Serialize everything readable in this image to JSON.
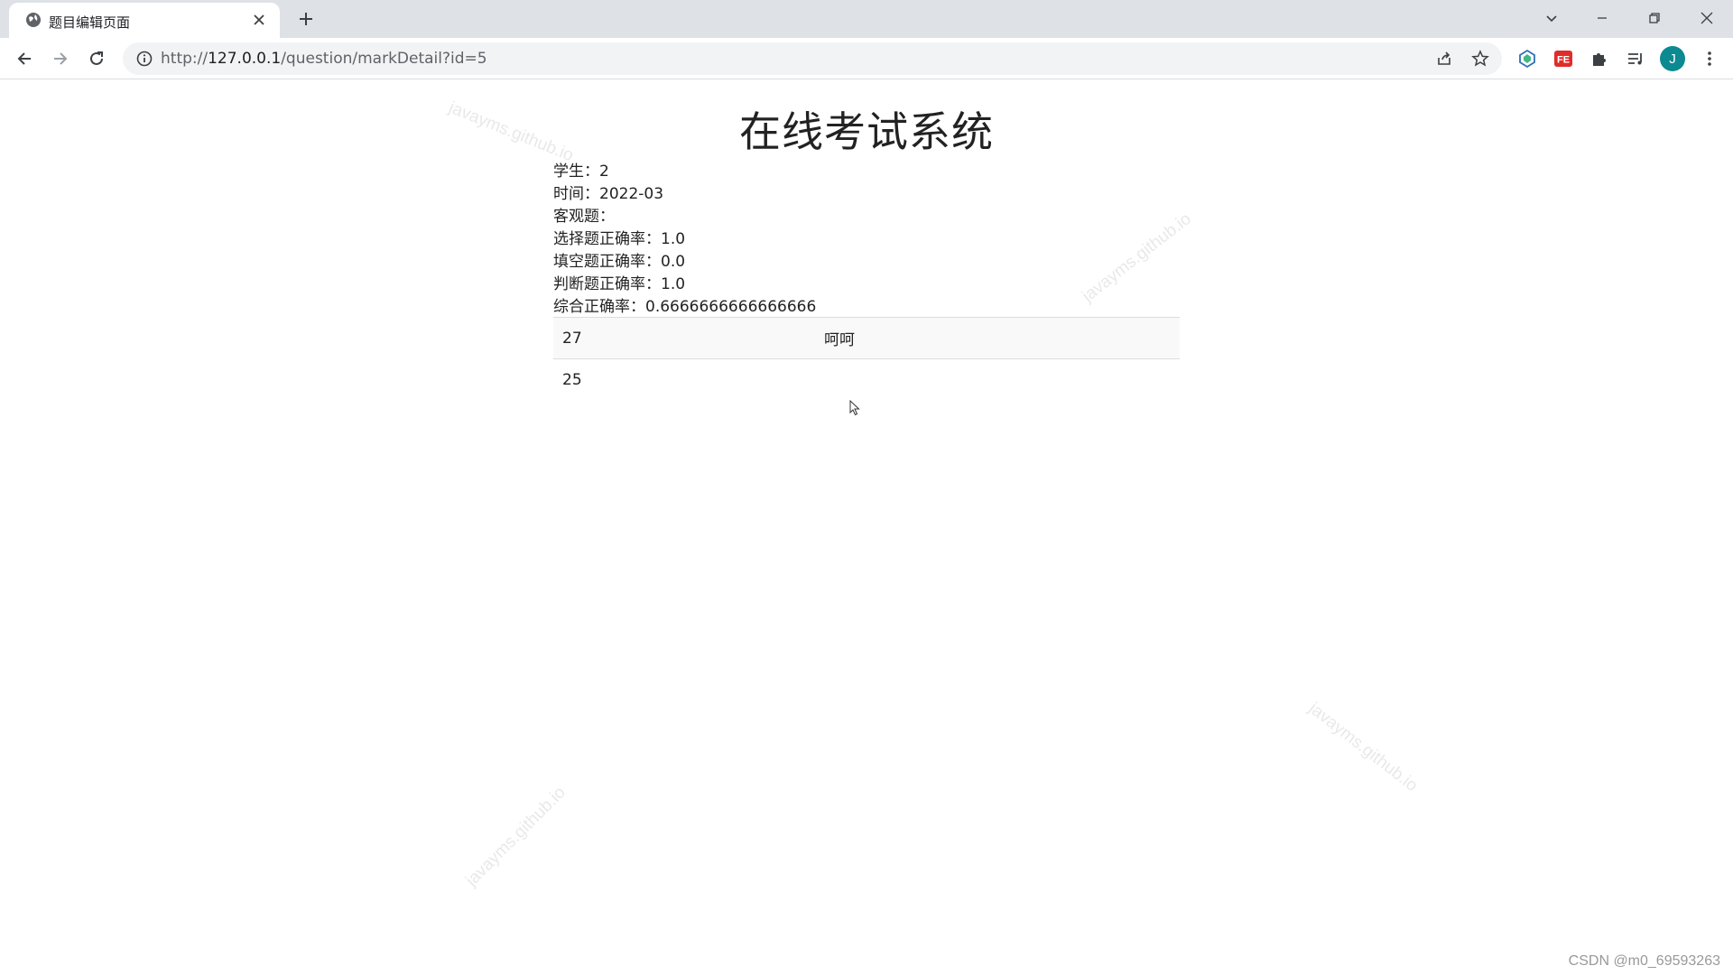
{
  "browser": {
    "tab_title": "题目编辑页面",
    "url_prefix": "http://",
    "url_host": "127.0.0.1",
    "url_path": "/question/markDetail?id=5",
    "profile_initial": "J"
  },
  "page": {
    "title": "在线考试系统",
    "info_rows": [
      "学生：2",
      "时间：2022-03",
      "客观题：",
      "选择题正确率：1.0",
      "填空题正确率：0.0",
      "判断题正确率：1.0",
      "综合正确率：0.6666666666666666"
    ],
    "table_rows": [
      {
        "col_a": "27",
        "col_b": "呵呵"
      },
      {
        "col_a": "25",
        "col_b": ""
      }
    ]
  },
  "watermarks": [
    "javayms.github.io",
    "javayms.github.io",
    "javayms.github.io",
    "javayms.github.io"
  ],
  "source_mark": "CSDN @m0_69593263",
  "icons": {
    "favicon": "globe-icon",
    "close": "close-icon",
    "new_tab": "plus-icon",
    "back": "arrow-left-icon",
    "forward": "arrow-right-icon",
    "reload": "reload-icon",
    "info": "info-icon",
    "share": "share-icon",
    "bookmark": "star-icon",
    "extensions": "puzzle-icon",
    "menu": "kebab-icon"
  }
}
